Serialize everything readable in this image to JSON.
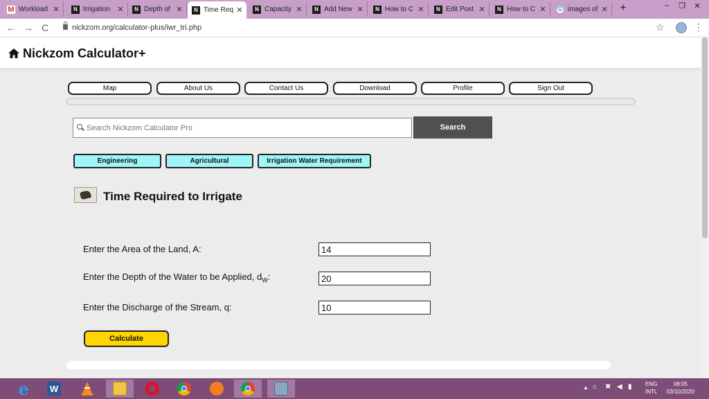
{
  "browser": {
    "tabs": [
      {
        "label": "Workload",
        "favicon": "gmail-icon"
      },
      {
        "label": "Irrigation",
        "favicon": "nickzom-icon"
      },
      {
        "label": "Depth of",
        "favicon": "nickzom-icon"
      },
      {
        "label": "Time Req",
        "favicon": "nickzom-icon",
        "active": true
      },
      {
        "label": "Capacity",
        "favicon": "nickzom-icon"
      },
      {
        "label": "Add New",
        "favicon": "nickzom-icon"
      },
      {
        "label": "How to C",
        "favicon": "nickzom-icon"
      },
      {
        "label": "Edit Post",
        "favicon": "nickzom-icon"
      },
      {
        "label": "How to C",
        "favicon": "nickzom-icon"
      },
      {
        "label": "images of",
        "favicon": "google-icon"
      }
    ],
    "new_tab": "+",
    "close_glyph": "✕",
    "url": "nickzom.org/calculator-plus/iwr_tri.php",
    "window_controls": [
      "–",
      "❐",
      "✕"
    ],
    "nav": {
      "back": "←",
      "forward": "→",
      "reload": "C"
    },
    "star": "☆",
    "menu": "⋮"
  },
  "site": {
    "title": "Nickzom Calculator+",
    "menu": [
      "Map",
      "About Us",
      "Contact Us",
      "Download",
      "Profile",
      "Sign Out"
    ],
    "search": {
      "placeholder": "Search Nickzom Calculator Pro",
      "button": "Search"
    },
    "categories": [
      "Engineering",
      "Agricultural",
      "Irrigation Water Requirement"
    ]
  },
  "calculator": {
    "title": "Time Required to Irrigate",
    "fields": [
      {
        "label": "Enter the Area of the Land, A:",
        "value": "14"
      },
      {
        "label_main": "Enter the Depth of the Water to be Applied, d",
        "label_sub": "W",
        "label_end": ":",
        "value": "20"
      },
      {
        "label": "Enter the Discharge of the Stream, q:",
        "value": "10"
      }
    ],
    "button": "Calculate"
  },
  "taskbar": {
    "apps": [
      "internet-explorer-icon",
      "word-icon",
      "vlc-icon",
      "file-explorer-icon",
      "opera-icon",
      "chrome-icon",
      "uc-browser-icon",
      "chrome-active-icon",
      "calculator-icon"
    ],
    "language": [
      "ENG",
      "INTL"
    ],
    "time": "08:05",
    "date": "03/10/2020"
  },
  "colors": {
    "tab_strip": "#c79fc8",
    "taskbar": "#7d4d78",
    "category_button": "#9ff6f8",
    "calculate_button": "#ffd400",
    "search_button": "#505050"
  }
}
